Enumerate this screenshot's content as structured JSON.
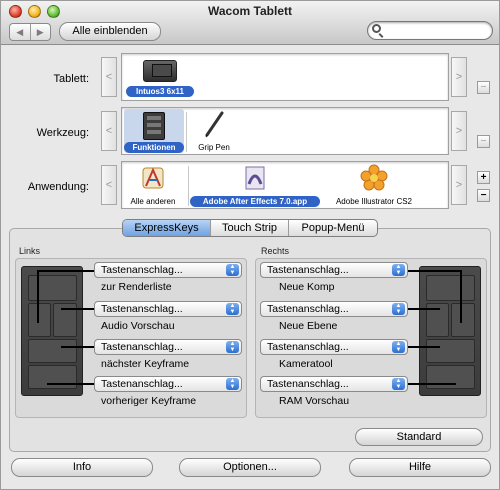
{
  "window": {
    "title": "Wacom Tablett"
  },
  "toolbar": {
    "back_label": "◀",
    "forward_label": "▶",
    "show_all_label": "Alle einblenden",
    "search_placeholder": "",
    "search_value": ""
  },
  "rows": {
    "tablet": {
      "label": "Tablett:",
      "items": [
        {
          "name": "Intuos3 6x11",
          "selected": true
        }
      ]
    },
    "tool": {
      "label": "Werkzeug:",
      "items": [
        {
          "name": "Funktionen",
          "selected": true
        },
        {
          "name": "Grip Pen",
          "selected": false
        }
      ]
    },
    "application": {
      "label": "Anwendung:",
      "items": [
        {
          "name": "Alle anderen",
          "selected": false
        },
        {
          "name": "Adobe After Effects 7.0.app",
          "selected": true
        },
        {
          "name": "Adobe Illustrator CS2",
          "selected": false
        }
      ]
    }
  },
  "scroll": {
    "left": "<",
    "right": ">",
    "minus": "−",
    "plus": "+"
  },
  "tabs": [
    {
      "label": "ExpressKeys",
      "active": true
    },
    {
      "label": "Touch Strip",
      "active": false
    },
    {
      "label": "Popup-Menü",
      "active": false
    }
  ],
  "left": {
    "title": "Links",
    "keys": [
      {
        "popup": "Tastenanschlag...",
        "desc": "zur Renderliste"
      },
      {
        "popup": "Tastenanschlag...",
        "desc": "Audio Vorschau"
      },
      {
        "popup": "Tastenanschlag...",
        "desc": "nächster Keyframe"
      },
      {
        "popup": "Tastenanschlag...",
        "desc": "vorheriger Keyframe"
      }
    ]
  },
  "right": {
    "title": "Rechts",
    "keys": [
      {
        "popup": "Tastenanschlag...",
        "desc": "Neue Komp"
      },
      {
        "popup": "Tastenanschlag...",
        "desc": "Neue Ebene"
      },
      {
        "popup": "Tastenanschlag...",
        "desc": "Kameratool"
      },
      {
        "popup": "Tastenanschlag...",
        "desc": "RAM Vorschau"
      }
    ]
  },
  "buttons": {
    "standard": "Standard",
    "info": "Info",
    "options": "Optionen...",
    "help": "Hilfe"
  },
  "colors": {
    "selection": "#2f63c5",
    "tab_active": "#6fa2e3",
    "popup_arrow": "#2d6fd0"
  }
}
